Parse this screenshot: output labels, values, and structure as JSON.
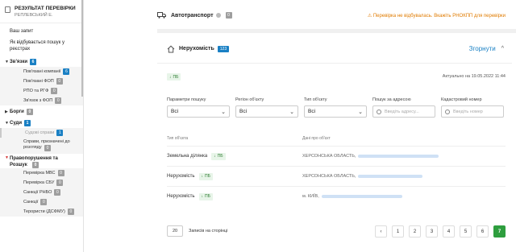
{
  "sidebar": {
    "header": {
      "title": "РЕЗУЛЬТАТ ПЕРЕВІРКИ",
      "subtitle": "РЕПЛЕВСЬКИЙ Е."
    },
    "links": [
      "Ваш запит",
      "Як відбувається пошук у реєстрах"
    ],
    "sections": [
      {
        "label": "Зв'язки",
        "count": "6",
        "badge": "blue",
        "caret": "▼"
      },
      {
        "label": "Борги",
        "count": "0",
        "badge": "grey",
        "caret": "▶"
      },
      {
        "label": "Суди",
        "count": "1",
        "badge": "blue",
        "caret": "▼"
      },
      {
        "label": "Правопорушення та Розшук",
        "count": "0",
        "badge": "grey",
        "caret": "▼"
      }
    ],
    "links_sub": [
      {
        "label": "Пов'язані компанії",
        "count": "6",
        "badge": "blue"
      },
      {
        "label": "Пов'язані ФОП",
        "count": "0",
        "badge": "grey"
      },
      {
        "label": "РПО та РГФ",
        "count": "0",
        "badge": "grey"
      },
      {
        "label": "Зв'язок з ФОП",
        "count": "0",
        "badge": "grey"
      }
    ],
    "courts_sub": [
      {
        "label": "Судові справи",
        "count": "1",
        "badge": "blue"
      },
      {
        "label": "Справи, призначені до розгляду",
        "count": "0",
        "badge": "grey"
      }
    ],
    "offences_sub": [
      {
        "label": "Перевірка МВС",
        "count": "0",
        "badge": "grey"
      },
      {
        "label": "Перевірка СБУ",
        "count": "0",
        "badge": "grey"
      },
      {
        "label": "Санкції РНБО",
        "count": "0",
        "badge": "grey"
      },
      {
        "label": "Санкції",
        "count": "0",
        "badge": "grey"
      },
      {
        "label": "Терористи (ДСФМУ)",
        "count": "0",
        "badge": "grey"
      }
    ]
  },
  "topbar": {
    "title": "Автотранспорт",
    "count": "0",
    "warning": "⚠ Перевірка не відбувалась. Вкажіть РНОКПП для перевірки"
  },
  "card": {
    "title": "Нерухомість",
    "count": "123",
    "collapse_label": "Згорнути",
    "pdf_label": "ПБ",
    "actual": "Актуально на 19.05.2022 11:44",
    "filters": [
      {
        "label": "Параметри пошуку",
        "value": "Всі",
        "type": "select"
      },
      {
        "label": "Регіон об'єкту",
        "value": "Всі",
        "type": "select"
      },
      {
        "label": "Тип об'єкту",
        "value": "Всі",
        "type": "select"
      },
      {
        "label": "Пошук за адресою",
        "placeholder": "Введіть адресу...",
        "type": "search"
      },
      {
        "label": "Кадастровий номер",
        "placeholder": "Введіть номер",
        "type": "search"
      }
    ],
    "columns": [
      "Тип об'єкта",
      "Дані про об'єкт"
    ],
    "rows": [
      {
        "type": "Земельна ділянка",
        "pdf": "ПБ",
        "address": "ХЕРСОНСЬКА ОБЛАСТЬ,",
        "blur_width": 100
      },
      {
        "type": "Нерухомість",
        "pdf": "ПБ",
        "address": "ХЕРСОНСЬКА ОБЛАСТЬ,",
        "blur_width": 80
      },
      {
        "type": "Нерухомість",
        "pdf": "ПБ",
        "address": "м. КИЇВ,",
        "blur_width": 100
      }
    ],
    "pagination": {
      "per_page": "20",
      "per_page_label": "Записів на сторінці",
      "prev": "‹",
      "pages": [
        "1",
        "2",
        "3",
        "4",
        "5",
        "6",
        "7"
      ],
      "active": "7"
    }
  },
  "colors": {
    "accent": "#1a80c4",
    "success": "#2e9e3e",
    "warning": "#e07b00"
  }
}
